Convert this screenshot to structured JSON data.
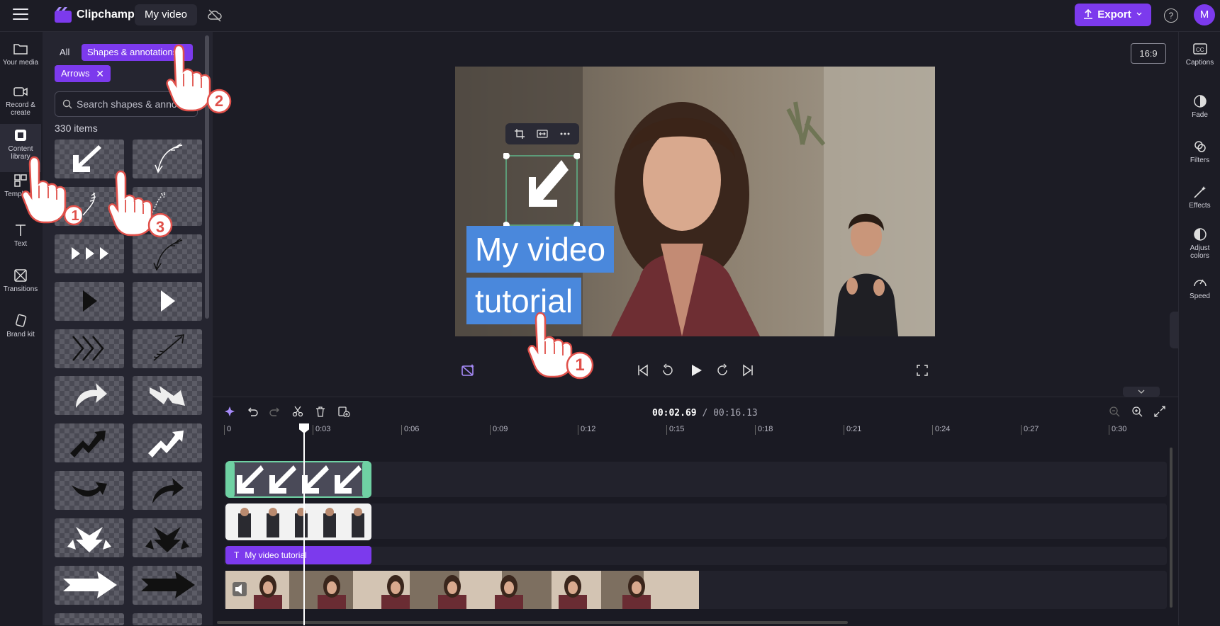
{
  "header": {
    "app_name": "Clipchamp",
    "video_title": "My video",
    "export_label": "Export",
    "avatar_initial": "M",
    "help_glyph": "?"
  },
  "left_rail": [
    {
      "label": "Your media",
      "icon": "folder-icon"
    },
    {
      "label": "Record & create",
      "icon": "video-camera-icon"
    },
    {
      "label": "Content library",
      "icon": "content-library-icon"
    },
    {
      "label": "Templates",
      "icon": "templates-icon"
    },
    {
      "label": "Text",
      "icon": "text-icon"
    },
    {
      "label": "Transitions",
      "icon": "transitions-icon"
    },
    {
      "label": "Brand kit",
      "icon": "brand-kit-icon"
    }
  ],
  "library": {
    "filter_all": "All",
    "filter_active": "Shapes & annotations",
    "subfilter": "Arrows",
    "search_placeholder": "Search shapes & annotations",
    "item_count": "330 items"
  },
  "preview": {
    "aspect_ratio": "16:9",
    "title_line1": "My video",
    "title_line2": "tutorial"
  },
  "right_rail": [
    {
      "label": "Captions",
      "icon": "captions-icon"
    },
    {
      "label": "Fade",
      "icon": "fade-icon"
    },
    {
      "label": "Filters",
      "icon": "filters-icon"
    },
    {
      "label": "Effects",
      "icon": "effects-icon"
    },
    {
      "label": "Adjust colors",
      "icon": "adjust-colors-icon"
    },
    {
      "label": "Speed",
      "icon": "speed-icon"
    }
  ],
  "timeline": {
    "current_time": "00:02.69",
    "total_time": "/ 00:16.13",
    "ruler_ticks": [
      "0",
      "0:03",
      "0:06",
      "0:09",
      "0:12",
      "0:15",
      "0:18",
      "0:21",
      "0:24",
      "0:27",
      "0:30"
    ],
    "text_clip_label": "My video tutorial"
  },
  "tutorial_markers": [
    "1",
    "2",
    "3",
    "1"
  ],
  "colors": {
    "accent": "#7c3aed",
    "title_bg": "#4a88dc",
    "selection": "#5fb58a"
  }
}
